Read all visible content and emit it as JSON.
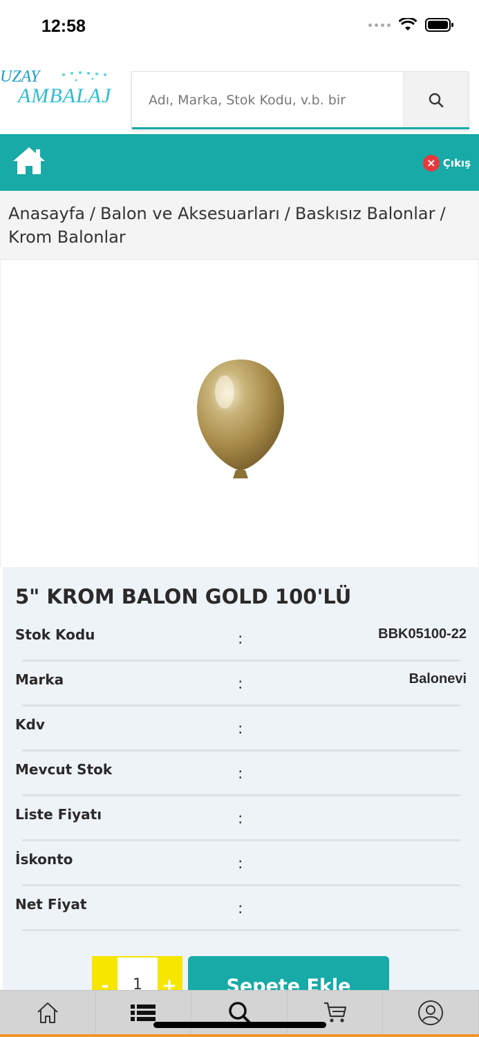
{
  "status_bar": {
    "time": "12:58"
  },
  "header": {
    "logo_line1": "UZAY",
    "logo_line2": "AMBALAJ",
    "search_placeholder": "Adı, Marka, Stok Kodu, v.b. bir"
  },
  "navbar": {
    "logout_label": "Çıkış"
  },
  "breadcrumb": [
    "Anasayfa",
    "Balon ve Aksesuarları",
    "Baskısız Balonlar",
    "Krom Balonlar"
  ],
  "product": {
    "title": "5\" KROM BALON GOLD 100'LÜ",
    "rows": [
      {
        "label": "Stok Kodu",
        "value": "BBK05100-22"
      },
      {
        "label": "Marka",
        "value": "Balonevi"
      },
      {
        "label": "Kdv",
        "value": ""
      },
      {
        "label": "Mevcut Stok",
        "value": ""
      },
      {
        "label": "Liste Fiyatı",
        "value": ""
      },
      {
        "label": "İskonto",
        "value": ""
      },
      {
        "label": "Net Fiyat",
        "value": ""
      }
    ],
    "colon": ":"
  },
  "cart": {
    "minus_label": "-",
    "plus_label": "+",
    "quantity": "1",
    "add_label": "Sepete Ekle"
  },
  "tabbar": {
    "items": [
      "home-icon",
      "list-icon",
      "search-icon",
      "cart-icon",
      "user-icon"
    ]
  },
  "colors": {
    "accent": "#17aaa6",
    "qty_yellow": "#f7e600",
    "logout_red": "#e8383d",
    "tabbar_orange": "#f39423"
  }
}
